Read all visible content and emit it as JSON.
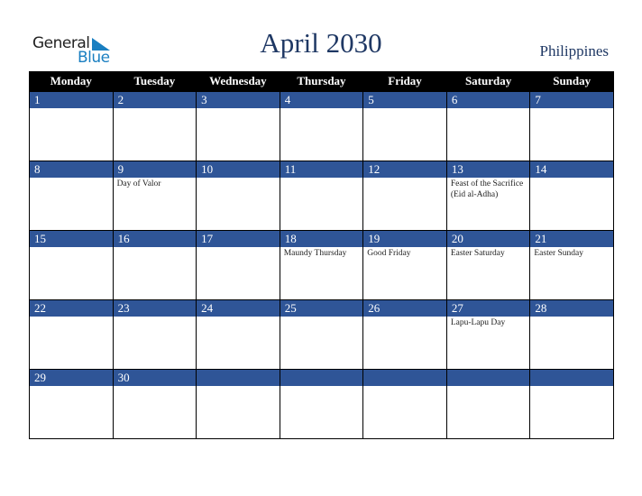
{
  "logo": {
    "line1": "General",
    "line2": "Blue"
  },
  "title": "April 2030",
  "country": "Philippines",
  "colors": {
    "header_bg": "#000000",
    "day_bar": "#2f5597",
    "title": "#1f3864",
    "logo_blue": "#1a7fc1"
  },
  "weekdays": [
    "Monday",
    "Tuesday",
    "Wednesday",
    "Thursday",
    "Friday",
    "Saturday",
    "Sunday"
  ],
  "weeks": [
    [
      {
        "day": "1",
        "event": ""
      },
      {
        "day": "2",
        "event": ""
      },
      {
        "day": "3",
        "event": ""
      },
      {
        "day": "4",
        "event": ""
      },
      {
        "day": "5",
        "event": ""
      },
      {
        "day": "6",
        "event": ""
      },
      {
        "day": "7",
        "event": ""
      }
    ],
    [
      {
        "day": "8",
        "event": ""
      },
      {
        "day": "9",
        "event": "Day of Valor"
      },
      {
        "day": "10",
        "event": ""
      },
      {
        "day": "11",
        "event": ""
      },
      {
        "day": "12",
        "event": ""
      },
      {
        "day": "13",
        "event": "Feast of the Sacrifice (Eid al-Adha)"
      },
      {
        "day": "14",
        "event": ""
      }
    ],
    [
      {
        "day": "15",
        "event": ""
      },
      {
        "day": "16",
        "event": ""
      },
      {
        "day": "17",
        "event": ""
      },
      {
        "day": "18",
        "event": "Maundy Thursday"
      },
      {
        "day": "19",
        "event": "Good Friday"
      },
      {
        "day": "20",
        "event": "Easter Saturday"
      },
      {
        "day": "21",
        "event": "Easter Sunday"
      }
    ],
    [
      {
        "day": "22",
        "event": ""
      },
      {
        "day": "23",
        "event": ""
      },
      {
        "day": "24",
        "event": ""
      },
      {
        "day": "25",
        "event": ""
      },
      {
        "day": "26",
        "event": ""
      },
      {
        "day": "27",
        "event": "Lapu-Lapu Day"
      },
      {
        "day": "28",
        "event": ""
      }
    ],
    [
      {
        "day": "29",
        "event": ""
      },
      {
        "day": "30",
        "event": ""
      },
      {
        "day": "",
        "event": ""
      },
      {
        "day": "",
        "event": ""
      },
      {
        "day": "",
        "event": ""
      },
      {
        "day": "",
        "event": ""
      },
      {
        "day": "",
        "event": ""
      }
    ]
  ]
}
